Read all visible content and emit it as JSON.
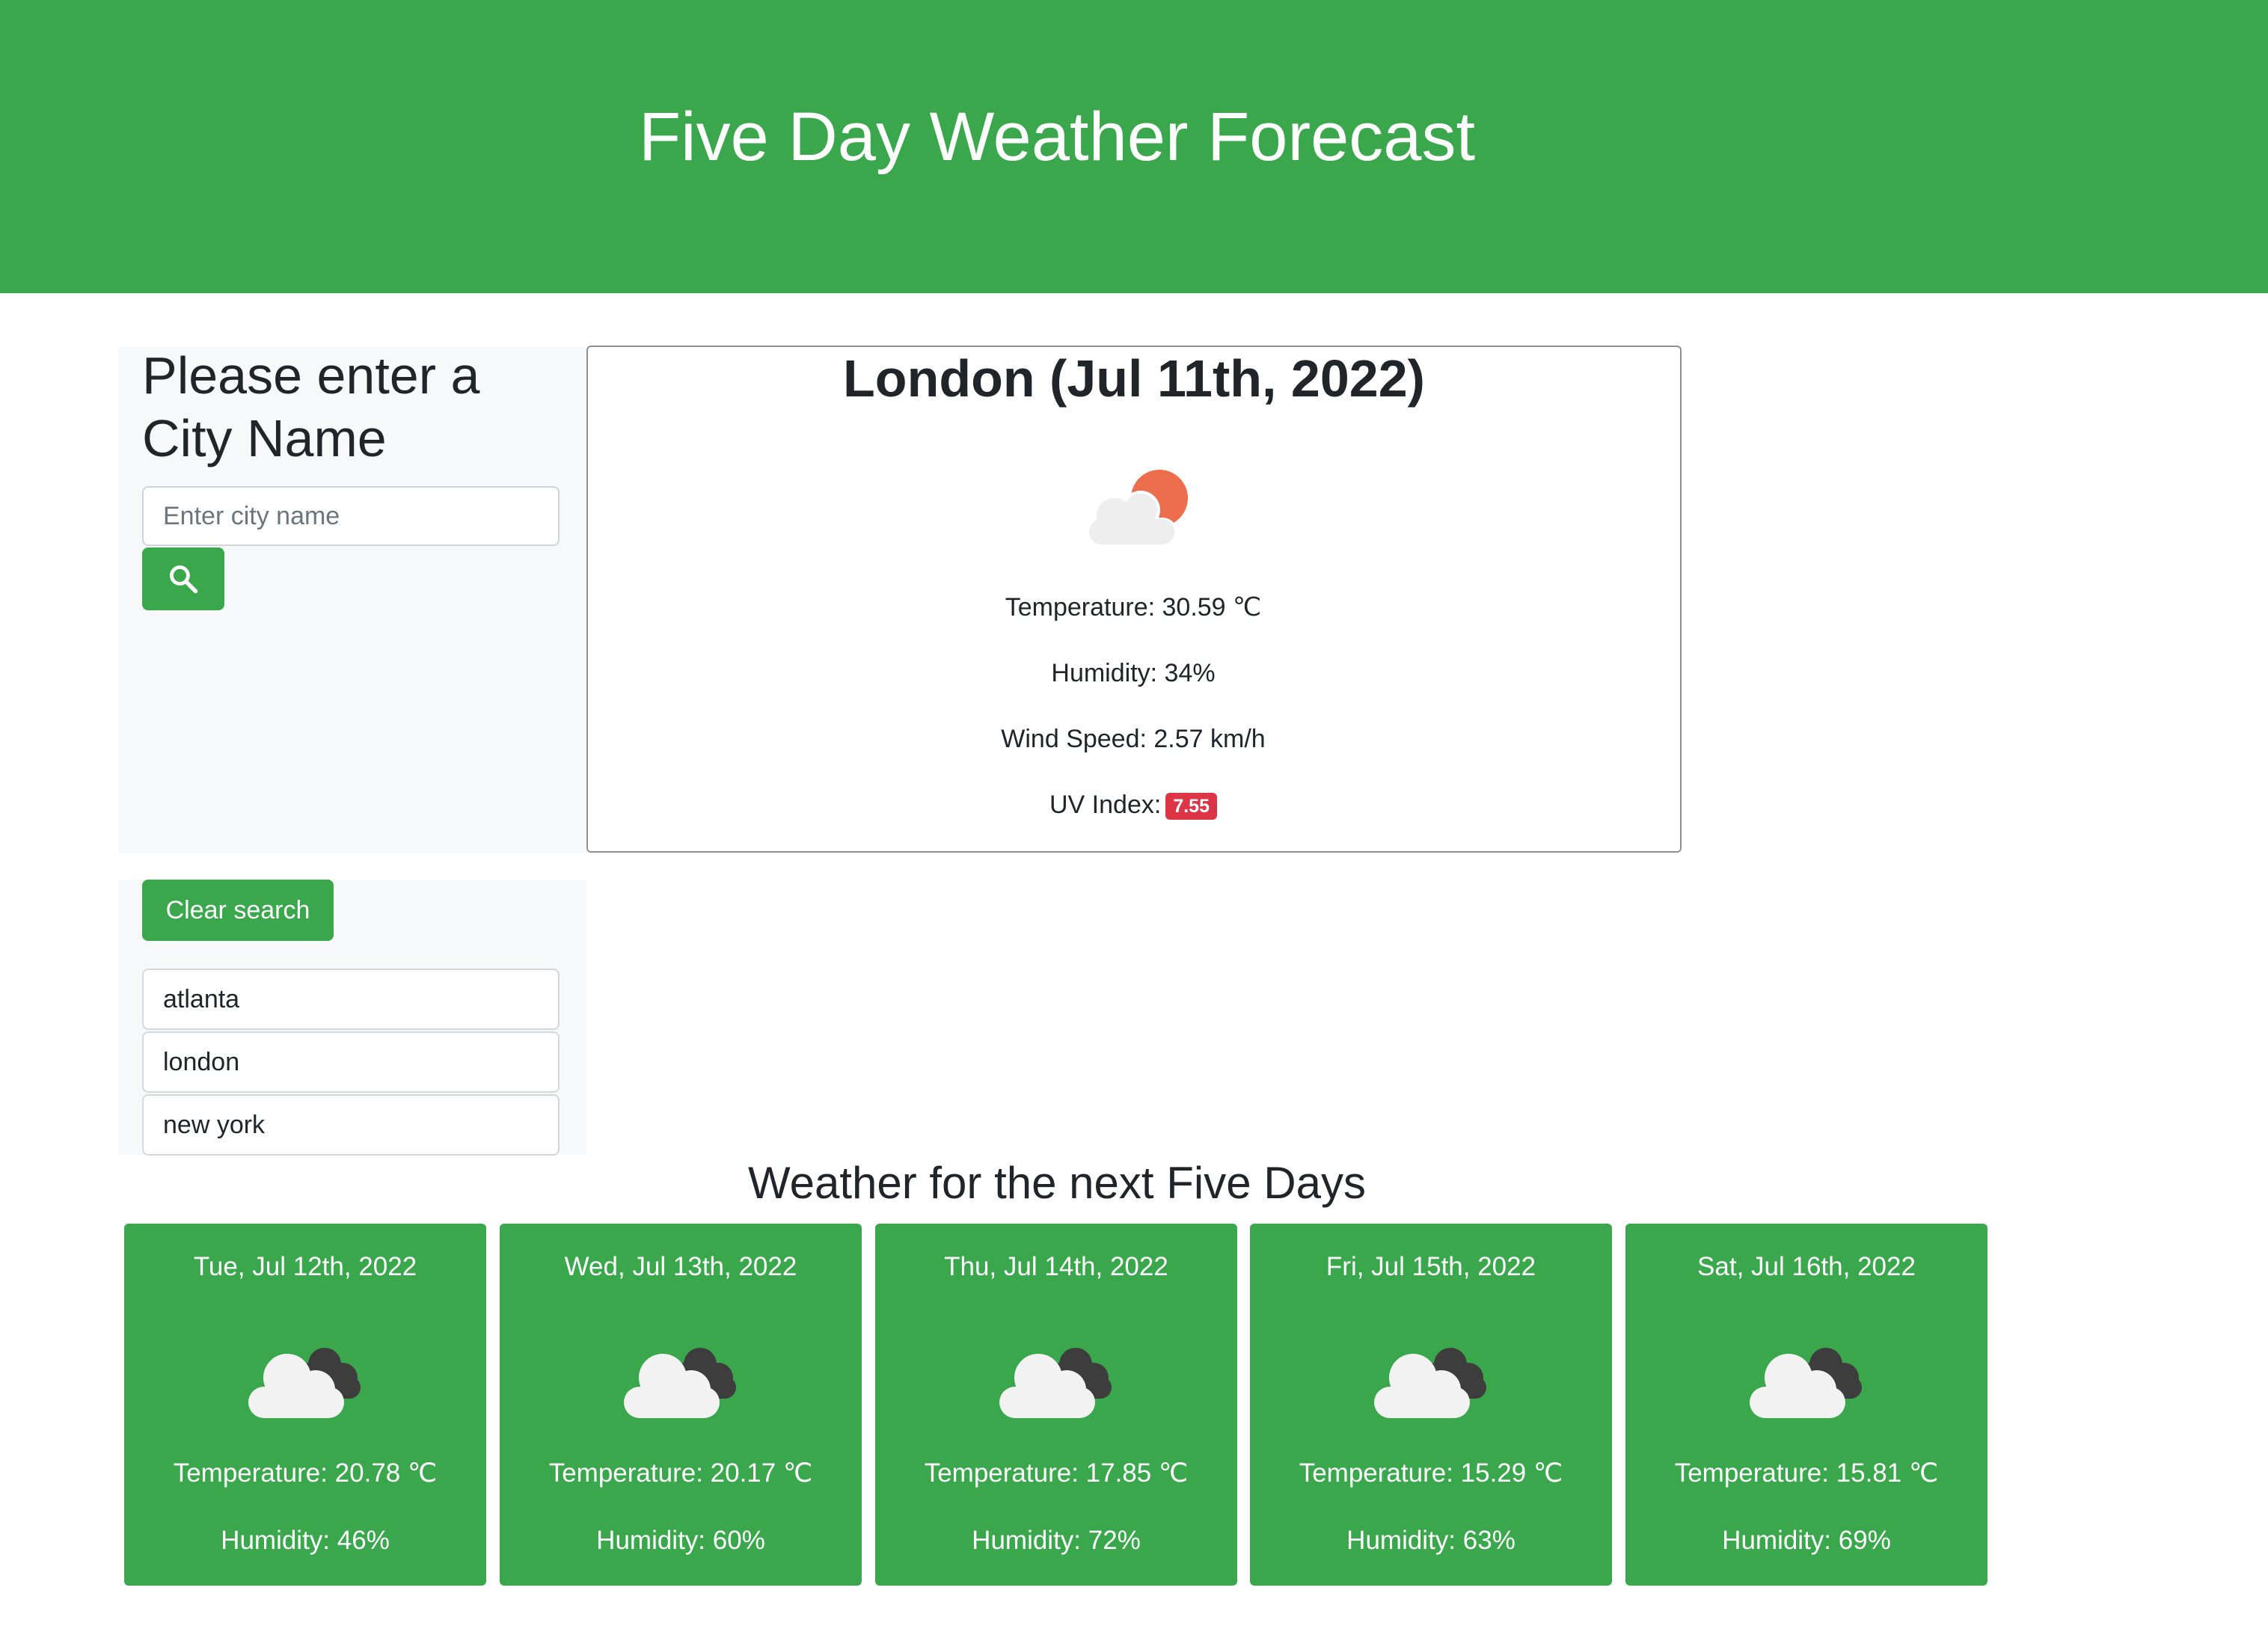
{
  "header": {
    "title": "Five Day Weather Forecast"
  },
  "search": {
    "title": "Please enter a City Name",
    "placeholder": "Enter city name",
    "value": "",
    "search_icon": "search-icon"
  },
  "current": {
    "title": "London (Jul 11th, 2022)",
    "icon": "partly-cloudy-day-icon",
    "temperature": "Temperature: 30.59 ℃",
    "humidity": "Humidity: 34%",
    "wind": "Wind Speed: 2.57 km/h",
    "uv_label": "UV Index:",
    "uv_value": "7.55",
    "uv_color": "#dc3545"
  },
  "history": {
    "clear_label": "Clear search",
    "items": [
      "atlanta",
      "london",
      "new york"
    ]
  },
  "forecast": {
    "title": "Weather for the next Five Days",
    "days": [
      {
        "date": "Tue, Jul 12th, 2022",
        "icon": "broken-clouds-icon",
        "temperature": "Temperature: 20.78 ℃",
        "humidity": "Humidity: 46%"
      },
      {
        "date": "Wed, Jul 13th, 2022",
        "icon": "broken-clouds-icon",
        "temperature": "Temperature: 20.17 ℃",
        "humidity": "Humidity: 60%"
      },
      {
        "date": "Thu, Jul 14th, 2022",
        "icon": "broken-clouds-icon",
        "temperature": "Temperature: 17.85 ℃",
        "humidity": "Humidity: 72%"
      },
      {
        "date": "Fri, Jul 15th, 2022",
        "icon": "broken-clouds-icon",
        "temperature": "Temperature: 15.29 ℃",
        "humidity": "Humidity: 63%"
      },
      {
        "date": "Sat, Jul 16th, 2022",
        "icon": "broken-clouds-icon",
        "temperature": "Temperature: 15.81 ℃",
        "humidity": "Humidity: 69%"
      }
    ]
  },
  "colors": {
    "accent": "#3ba74d",
    "uv_high": "#dc3545"
  }
}
